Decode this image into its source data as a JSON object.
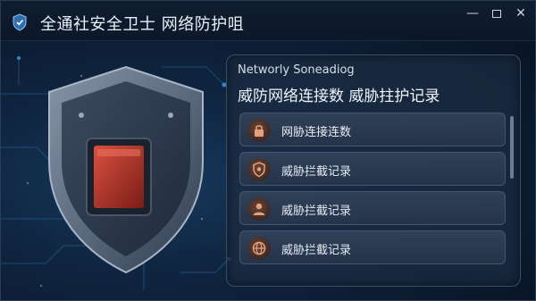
{
  "window": {
    "title": "全通社安全卫士 网络防护咀",
    "controls": {
      "minimize": "—",
      "close": "✕"
    }
  },
  "panel": {
    "subtitle": "Networly Soneadiog",
    "title": "威防网络连接数 威胁拄护记录",
    "items": [
      {
        "label": "网胁连接连数",
        "icon": "lock-icon"
      },
      {
        "label": "威胁拦截记录",
        "icon": "shield-alert-icon"
      },
      {
        "label": "威胁拦截记录",
        "icon": "user-icon"
      },
      {
        "label": "威胁拦截记录",
        "icon": "globe-icon"
      }
    ]
  },
  "colors": {
    "accent": "#c0392b",
    "background": "#0f2540",
    "icon_accent": "#e8a07a"
  }
}
